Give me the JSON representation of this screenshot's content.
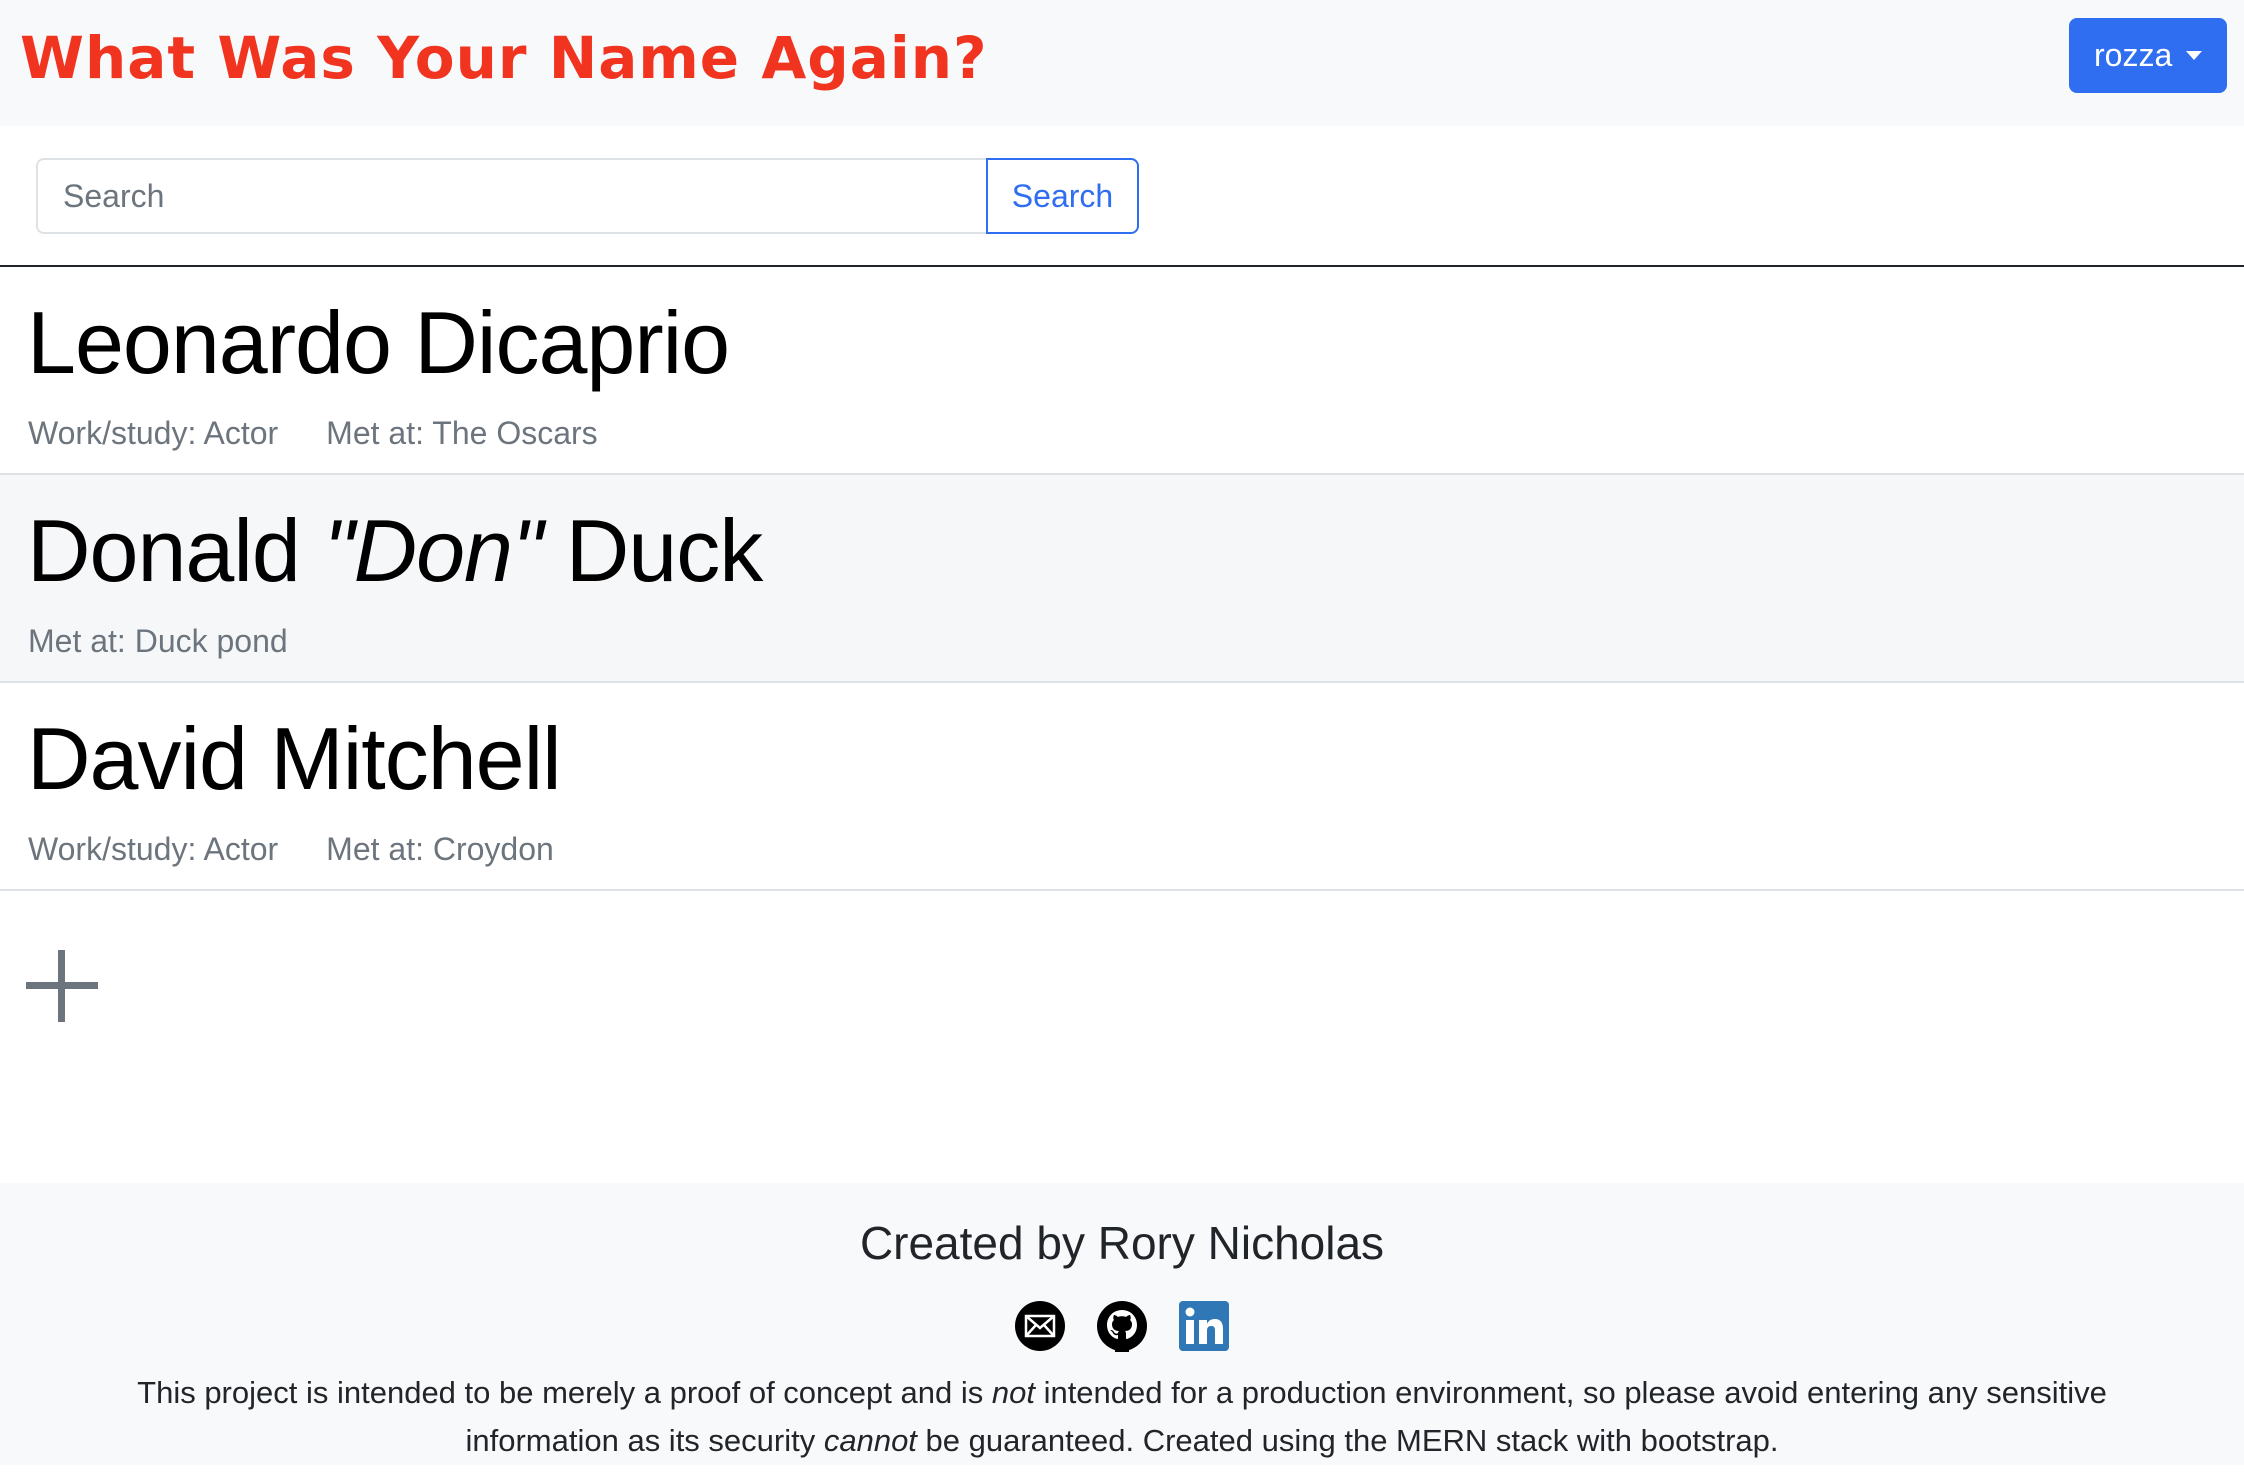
{
  "header": {
    "title": "What Was Your Name Again?",
    "user_menu_label": "rozza",
    "accent": "#f1341f",
    "button_color": "#2f6ef0"
  },
  "search": {
    "placeholder": "Search",
    "value": "",
    "button_label": "Search"
  },
  "contacts": [
    {
      "name_first": "Leonardo Dicaprio",
      "nickname": "",
      "name_last": "",
      "work": "Work/study: Actor",
      "met_at": "Met at: The Oscars"
    },
    {
      "name_first": "Donald ",
      "nickname": "\"Don\"",
      "name_last": " Duck",
      "work": "",
      "met_at": "Met at: Duck pond"
    },
    {
      "name_first": "David Mitchell",
      "nickname": "",
      "name_last": "",
      "work": "Work/study: Actor",
      "met_at": "Met at: Croydon"
    }
  ],
  "add_button": {
    "icon": "plus-icon"
  },
  "footer": {
    "title": "Created by Rory Nicholas",
    "icons": [
      "email-icon",
      "github-icon",
      "linkedin-icon"
    ],
    "note_part1": "This project is intended to be merely a proof of concept and is ",
    "note_em1": "not",
    "note_part2": " intended for a production environment, so please avoid entering any sensitive information as its security ",
    "note_em2": "cannot",
    "note_part3": " be guaranteed. Created using the MERN stack with bootstrap."
  }
}
